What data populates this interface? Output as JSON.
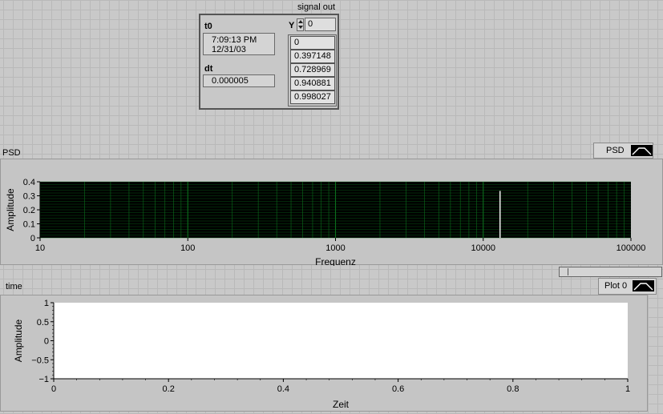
{
  "cluster": {
    "t0_label": "t0",
    "t0_time": "7:09:13 PM",
    "t0_date": "12/31/03",
    "dt_label": "dt",
    "dt_value": "0.000005",
    "signal_label": "signal out",
    "y_label": "Y",
    "y_index": "0",
    "values": [
      "0",
      "0.397148",
      "0.728969",
      "0.940881",
      "0.998027"
    ]
  },
  "psd": {
    "title": "PSD",
    "legend_label": "PSD",
    "xlabel": "Frequenz",
    "ylabel": "Amplitude",
    "colors": {
      "plot_bg": "#000000",
      "grid": "#0b6e1c",
      "trace": "#ffffff"
    }
  },
  "time": {
    "title": "time",
    "legend_label": "Plot 0",
    "xlabel": "Zeit",
    "ylabel": "Amplitude",
    "colors": {
      "plot_bg": "#ffffff"
    }
  },
  "chart_data": [
    {
      "type": "line",
      "name": "PSD",
      "xscale": "log",
      "xlim": [
        10,
        100000
      ],
      "ylim": [
        0,
        0.4
      ],
      "xticks": [
        "10",
        "100",
        "1000",
        "10000",
        "100000"
      ],
      "yticks": [
        "0",
        "0.1",
        "0.2",
        "0.3",
        "0.4"
      ],
      "series": [
        {
          "name": "PSD",
          "x": [
            13000,
            13000
          ],
          "y": [
            0,
            0.335
          ]
        }
      ],
      "grid": true
    },
    {
      "type": "line",
      "name": "time",
      "xlim": [
        0,
        1
      ],
      "ylim": [
        -1,
        1
      ],
      "xticks": [
        "0",
        "0.2",
        "0.4",
        "0.6",
        "0.8",
        "1"
      ],
      "yticks": [
        "−1",
        "−0.5",
        "0",
        "0.5",
        "1"
      ],
      "series": [
        {
          "name": "Plot 0",
          "x": [],
          "y": []
        }
      ],
      "grid": false
    }
  ]
}
